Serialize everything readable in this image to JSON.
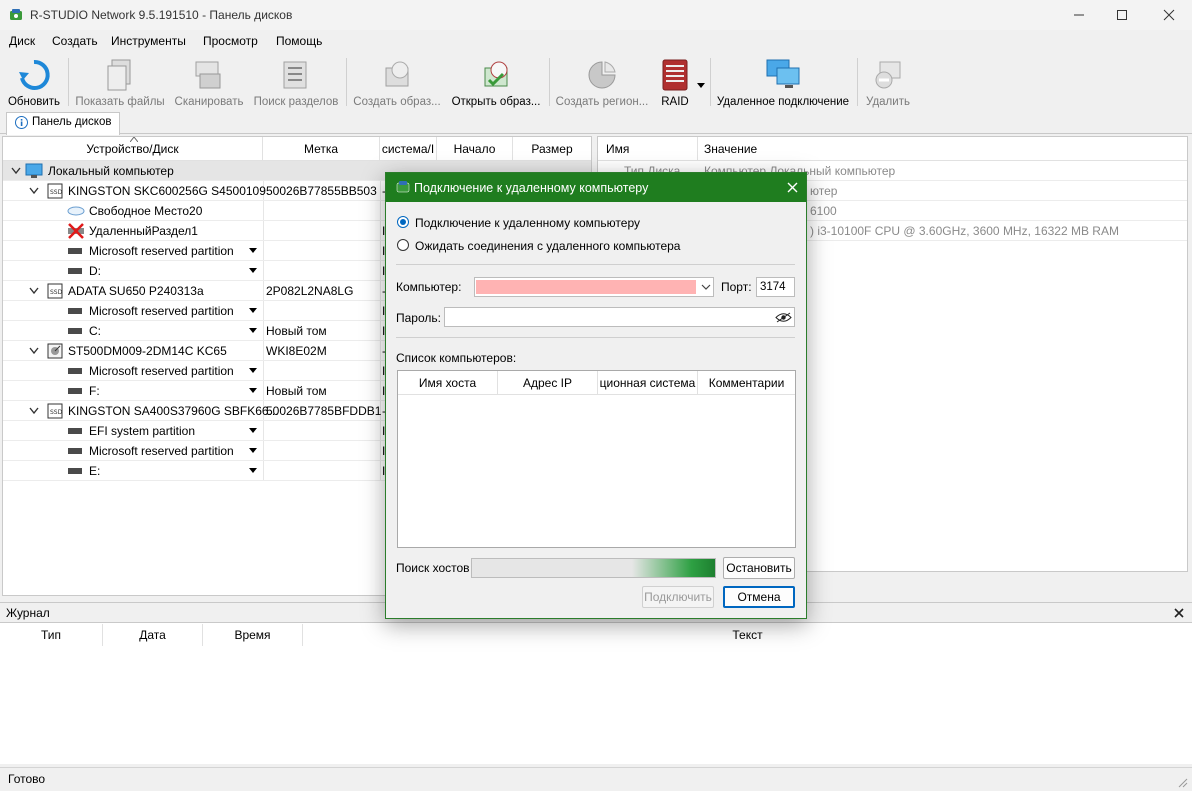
{
  "window": {
    "title": "R-STUDIO Network 9.5.191510 - Панель дисков"
  },
  "menu": [
    "Диск",
    "Создать",
    "Инструменты",
    "Просмотр",
    "Помощь"
  ],
  "toolbar": {
    "refresh": "Обновить",
    "show_files": "Показать файлы",
    "scan": "Сканировать",
    "find_partitions": "Поиск разделов",
    "create_image": "Создать образ...",
    "open_image": "Открыть образ...",
    "create_region": "Создать регион...",
    "raid": "RAID",
    "remote": "Удаленное подключение",
    "delete": "Удалить"
  },
  "tab": {
    "label": "Панель дисков"
  },
  "disk_table": {
    "headers": [
      "Устройство/Диск",
      "Метка",
      "систем​а/Ι",
      "Начало",
      "Размер"
    ],
    "rows": [
      {
        "name": "Локальный компьютер",
        "label": ""
      },
      {
        "name": "KINGSTON SKC600256G S4500109",
        "label": "50026B77855BB503"
      },
      {
        "name": "Свободное Место20",
        "label": ""
      },
      {
        "name": "УдаленныйРаздел1",
        "label": ""
      },
      {
        "name": "Microsoft reserved partition",
        "label": ""
      },
      {
        "name": "D:",
        "label": ""
      },
      {
        "name": "ADATA SU650 P240313a",
        "label": "2P082L2NA8LG"
      },
      {
        "name": "Microsoft reserved partition",
        "label": ""
      },
      {
        "name": "C:",
        "label": "Новый том"
      },
      {
        "name": "ST500DM009-2DM14C KC65",
        "label": "WKI8E02M"
      },
      {
        "name": "Microsoft reserved partition",
        "label": ""
      },
      {
        "name": "F:",
        "label": "Новый том"
      },
      {
        "name": "KINGSTON SA400S37960G SBFK66...",
        "label": "50026B7785BFDDB1"
      },
      {
        "name": "EFI system partition",
        "label": ""
      },
      {
        "name": "Microsoft reserved partition",
        "label": ""
      },
      {
        "name": "E:",
        "label": ""
      }
    ]
  },
  "props_table": {
    "headers": [
      "Имя",
      "Значение"
    ],
    "rows": [
      {
        "name": "Тип Диска",
        "value": "Компьютер Локальный компьютер"
      },
      {
        "name": "",
        "value": "ютер"
      },
      {
        "name": "",
        "value": "6100"
      },
      {
        "name": "",
        "value": ") i3-10100F CPU @ 3.60GHz, 3600 MHz, 16322 MB RAM"
      }
    ]
  },
  "journal": {
    "title": "Журнал",
    "headers": [
      "Тип",
      "Дата",
      "Время",
      "Текст"
    ]
  },
  "status": "Готово",
  "dialog": {
    "title": "Подключение к удаленному компьютеру",
    "radio_connect": "Подключение к удаленному компьютеру",
    "radio_wait": "Ожидать соединения с удаленного компьютера",
    "computer_label": "Компьютер:",
    "port_label": "Порт:",
    "port_value": "3174",
    "password_label": "Пароль:",
    "list_label": "Список компьютеров:",
    "list_headers": [
      "Имя хоста",
      "Адрес IP",
      "ционная система",
      "Комментарии"
    ],
    "search_label": "Поиск хостов",
    "stop": "Остановить",
    "connect": "Подключить",
    "cancel": "Отмена",
    "computer_field_color": "#ffb3b3",
    "accent": "#1f7d1f"
  }
}
